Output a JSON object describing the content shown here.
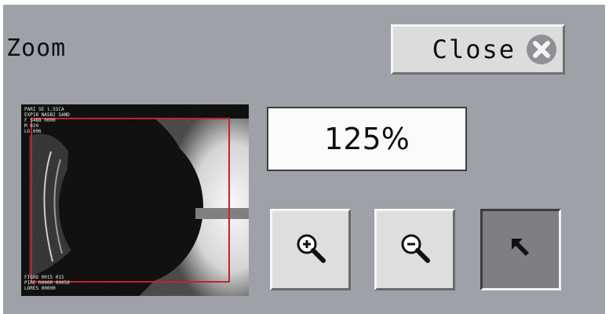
{
  "dialog": {
    "title": "Zoom",
    "close_label": "Close",
    "zoom_level": "125%"
  },
  "icons": {
    "close": "close-icon",
    "zoom_in": "zoom-in-icon",
    "zoom_out": "zoom-out-icon",
    "pointer": "arrow-pointer-icon"
  },
  "thumbnail": {
    "overlay_color": "#c0252b",
    "header_lines": [
      "PARI SE 1.5SCA",
      "EXP18 NASB2 SAND",
      "F S4B8 0000",
      "M 020",
      "LG 006"
    ],
    "footer_lines": [
      "FIGRD 0015 015",
      "PIRE R000R 00050",
      "LORES 00000"
    ]
  },
  "colors": {
    "panel_bg": "#9ea1a8",
    "button_face": "#dedede",
    "pointer_active": "#7d7f85"
  }
}
